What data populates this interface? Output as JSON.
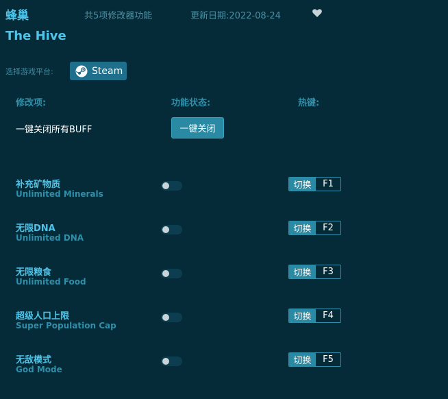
{
  "header": {
    "title_cn": "蜂巢",
    "count_text": "共5项修改器功能",
    "date_text": "更新日期:2022-08-24",
    "title_en": "The Hive",
    "favorite_icon": "heart-icon"
  },
  "platform": {
    "label": "选择游戏平台:",
    "button_label": "Steam",
    "icon": "steam-icon"
  },
  "columns": {
    "mod": "修改项:",
    "status": "功能状态:",
    "hotkey": "热键:"
  },
  "all_buff": {
    "label": "一键关闭所有BUFF",
    "button_label": "一键关闭"
  },
  "items": [
    {
      "name_cn": "补充矿物质",
      "name_en": "Unlimited Minerals",
      "switch_label": "切换",
      "key": "F1",
      "enabled": false
    },
    {
      "name_cn": "无限DNA",
      "name_en": "Unlimited DNA",
      "switch_label": "切换",
      "key": "F2",
      "enabled": false
    },
    {
      "name_cn": "无限粮食",
      "name_en": "Unlimited Food",
      "switch_label": "切换",
      "key": "F3",
      "enabled": false
    },
    {
      "name_cn": "超级人口上限",
      "name_en": "Super Population Cap",
      "switch_label": "切换",
      "key": "F4",
      "enabled": false
    },
    {
      "name_cn": "无敌模式",
      "name_en": "God Mode",
      "switch_label": "切换",
      "key": "F5",
      "enabled": false
    }
  ],
  "colors": {
    "background": "#062b38",
    "accent": "#4fc3e8",
    "button": "#2a8aa3"
  }
}
